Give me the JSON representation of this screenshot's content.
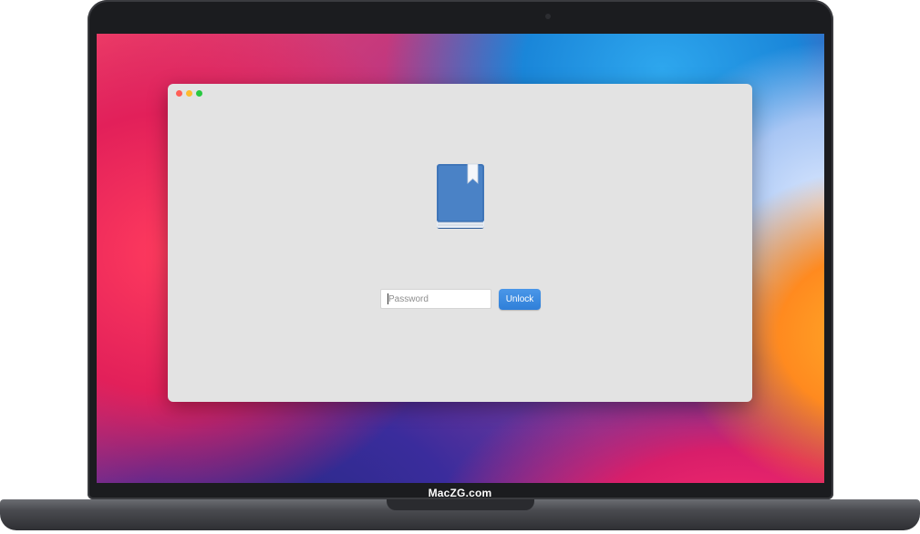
{
  "window": {
    "traffic_lights": {
      "close_color": "#ff5f57",
      "minimize_color": "#febc2e",
      "zoom_color": "#28c840"
    },
    "app_icon": "book-with-bookmark-icon",
    "password": {
      "value": "",
      "placeholder": "Password"
    },
    "unlock_button": {
      "label": "Unlock",
      "color": "#3a8ae0"
    }
  },
  "device": {
    "brand_label": "MacZG.com"
  },
  "colors": {
    "window_background": "#e3e3e3",
    "book_cover": "#3f75b8",
    "bezel": "#1b1c1f"
  }
}
